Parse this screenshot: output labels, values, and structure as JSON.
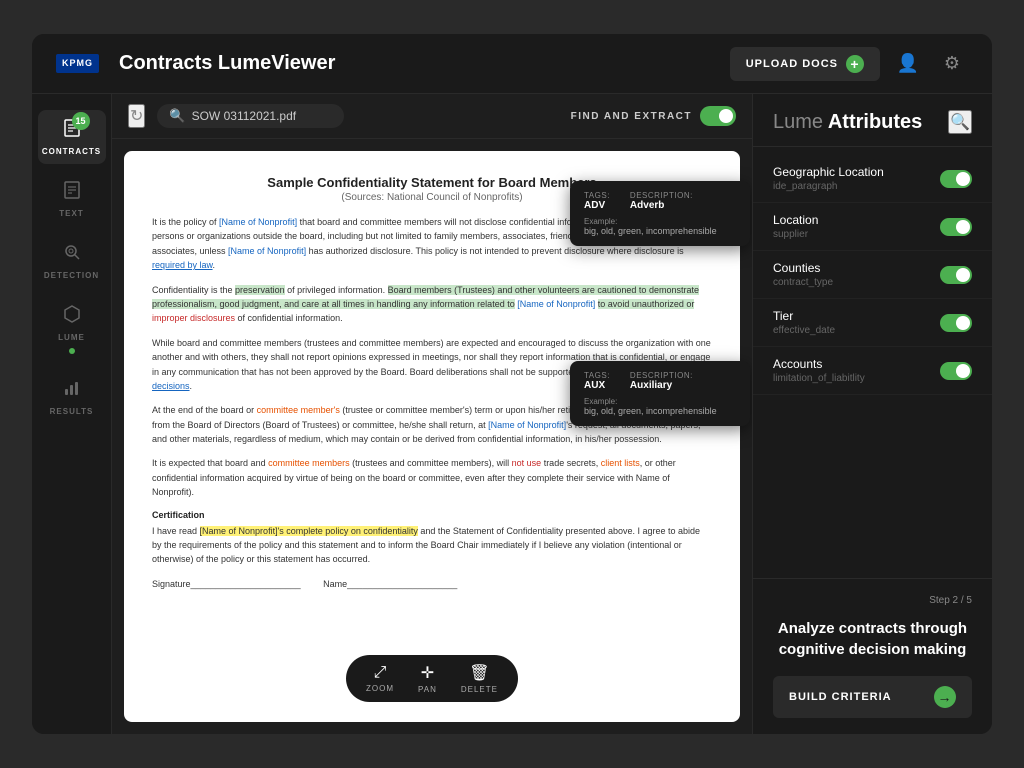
{
  "header": {
    "logo": "KPMG",
    "title_light": "Contracts ",
    "title_bold": "LumeViewer",
    "upload_btn": "UPLOAD DOCS",
    "upload_plus": "+",
    "user_icon": "👤",
    "settings_icon": "⚙"
  },
  "toolbar": {
    "file_name": "SOW 03112021.pdf",
    "find_extract_label": "FIND AND EXTRACT"
  },
  "sidebar": {
    "items": [
      {
        "id": "contracts",
        "label": "CONTRACTS",
        "icon": "📄",
        "badge": "15",
        "active": true
      },
      {
        "id": "text",
        "label": "TEXT",
        "icon": "📃",
        "active": false
      },
      {
        "id": "detection",
        "label": "DETECTION",
        "icon": "🎯",
        "active": false
      },
      {
        "id": "lume",
        "label": "LUME",
        "icon": "⬡",
        "active": false,
        "dot": true
      },
      {
        "id": "results",
        "label": "RESULTS",
        "icon": "📊",
        "active": false
      }
    ]
  },
  "document": {
    "title": "Sample Confidentiality Statement for Board Members",
    "subtitle": "(Sources: National Council of Nonprofits)",
    "paragraphs": [
      "It is the policy of [Name of Nonprofit] that board and committee members will not disclose confidential information of [Name of Nonprofit] to persons or organizations outside the board unless [Name of Nonprofit] has authorized disclosure. This policy is not intended to prevent disclosure where disclosure is required by law.",
      "Confidentiality is the preservation of privileged information. Board members (Trustees) and other volunteers are cautioned to demonstrate professionalism, good judgment, and care at all times in handling any information related to [Name of Nonprofit] to avoid unauthorized or improper disclosures of confidential information.",
      "While board and committee members (trustees and committee members) are expected and encouraged to discuss the organization with one another and with others, they shall not report opinions expressed in meetings, nor shall they report information that is confidential, or engage in any communication that has not been approved by the Board. Board deliberations shall not be supported by board policy, procedures, or decisions.",
      "At the end of the board or committee member's (trustee or committee member's) term or upon his/her retirement, resignation or removal from the Board of Directors (Board of Trustees) or committee, he/she shall return, at [Name of Nonprofit]'s request, all documents, papers, and other materials, regardless of medium, which may contain or be derived from confidential information, in his/her possession.",
      "It is expected that board and committee members (trustees and committee members), will not use trade secrets, client lists, or other confidential information acquired by virtue of being on the board or committee, even after they complete their service with Name of Nonprofit)."
    ],
    "certification": {
      "title": "Certification",
      "text": "I have read [Name of Nonprofit]'s complete policy on confidentiality and the Statement of Confidentiality presented above. I agree to abide by the requirements of the policy and this statement and to inform the Board Chair immediately if I believe any violation (intentional or otherwise) of the policy or this statement has occurred.",
      "signature_label": "Signature",
      "name_label": "Name"
    }
  },
  "tooltips": [
    {
      "id": "tooltip1",
      "tags_label": "Tags:",
      "desc_label": "Description:",
      "tag_value": "ADV",
      "desc_value": "Adverb",
      "example_label": "Example:",
      "example_value": "big, old, green, incomprehensible"
    },
    {
      "id": "tooltip2",
      "tags_label": "Tags:",
      "desc_label": "Description:",
      "tag_value": "AUX",
      "desc_value": "Auxiliary",
      "example_label": "Example:",
      "example_value": "big, old, green, incomprehensible"
    }
  ],
  "bottom_toolbar": {
    "zoom_label": "ZOOM",
    "pan_label": "PAN",
    "delete_label": "DELETE"
  },
  "right_panel": {
    "title_lume": "Lume",
    "title_attr": " Attributes",
    "attributes": [
      {
        "name": "Geographic Location",
        "sub": "ide_paragraph",
        "enabled": true
      },
      {
        "name": "Location",
        "sub": "supplier",
        "enabled": true
      },
      {
        "name": "Counties",
        "sub": "contract_type",
        "enabled": true
      },
      {
        "name": "Tier",
        "sub": "effective_date",
        "enabled": true
      },
      {
        "name": "Accounts",
        "sub": "limitation_of_liabitlity",
        "enabled": true
      }
    ],
    "step": "Step 2 / 5",
    "cta": "Analyze contracts through cognitive decision making",
    "build_criteria_btn": "BUILD CRITERIA"
  }
}
